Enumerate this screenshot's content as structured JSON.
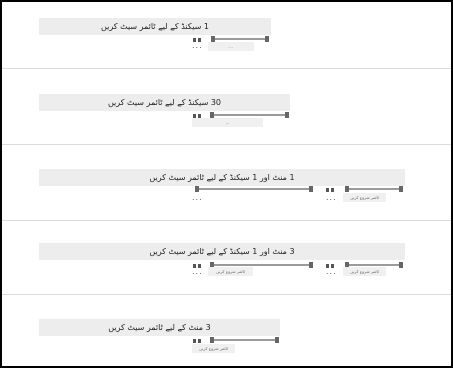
{
  "rows": [
    {
      "title": "1 سیکنڈ کے لیے ٹائمر سیٹ کریں",
      "dots_left": "...",
      "label": "..."
    },
    {
      "title": "30 سیکنڈ کے لیے ٹائمر سیٹ کریں",
      "label": "..."
    },
    {
      "title": "1 منٹ اور 1 سیکنڈ کے لیے ٹائمر سیٹ کریں",
      "dots_left": "...",
      "dots_right": "...",
      "label": "ٹائمر شروع کریں"
    },
    {
      "title": "3 منٹ اور 1 سیکنڈ کے لیے ٹائمر سیٹ کریں",
      "dots_left": "...",
      "dots_right": "...",
      "label_left": "ٹائمر شروع کریں",
      "label_right": "ٹائمر شروع کریں"
    },
    {
      "title": "3 منٹ کے لیے ٹائمر سیٹ کریں",
      "label": "ٹائمر شروع کریں"
    }
  ]
}
